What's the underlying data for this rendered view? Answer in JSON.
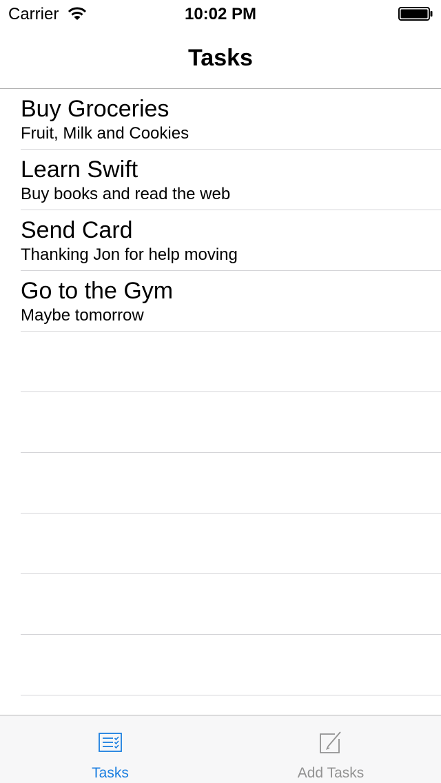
{
  "status_bar": {
    "carrier": "Carrier",
    "time": "10:02 PM",
    "icons": [
      "wifi-icon",
      "battery-icon"
    ]
  },
  "nav": {
    "title": "Tasks"
  },
  "tasks": [
    {
      "title": "Buy Groceries",
      "subtitle": "Fruit, Milk and Cookies"
    },
    {
      "title": "Learn Swift",
      "subtitle": "Buy books and read the web"
    },
    {
      "title": "Send Card",
      "subtitle": "Thanking Jon for help moving"
    },
    {
      "title": "Go to the Gym",
      "subtitle": "Maybe tomorrow"
    },
    {
      "title": "",
      "subtitle": ""
    },
    {
      "title": "",
      "subtitle": ""
    },
    {
      "title": "",
      "subtitle": ""
    },
    {
      "title": "",
      "subtitle": ""
    },
    {
      "title": "",
      "subtitle": ""
    },
    {
      "title": "",
      "subtitle": ""
    }
  ],
  "tab_bar": {
    "tabs": [
      {
        "label": "Tasks",
        "icon": "task-list-icon",
        "selected": true
      },
      {
        "label": "Add Tasks",
        "icon": "compose-icon",
        "selected": false
      }
    ]
  },
  "colors": {
    "accent": "#1a7ee0",
    "inactive": "#929292",
    "separator": "#d5d5d8"
  }
}
